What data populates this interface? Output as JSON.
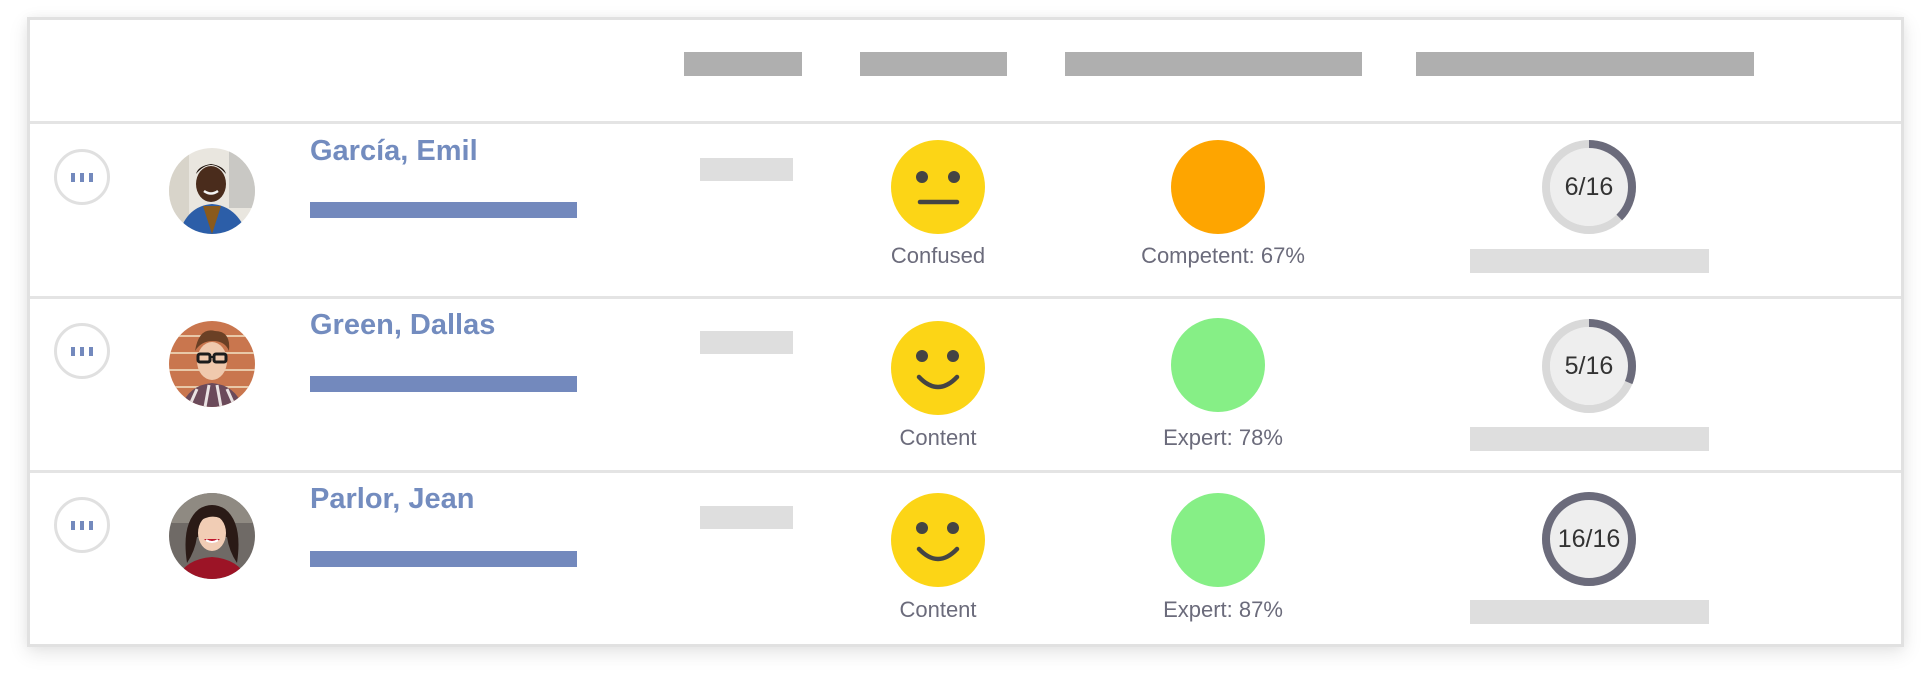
{
  "colors": {
    "accent": "#738cbf",
    "header_placeholder": "#afafaf",
    "row_placeholder": "#dedede",
    "mood_yellow": "#fcd516",
    "mood_features": "#444444",
    "status_competent": "#fea500",
    "status_expert": "#86ef86",
    "ring_track": "#d9d9d9",
    "ring_progress": "#6b6b7b",
    "ring_fill": "#eeeeee"
  },
  "rows": [
    {
      "name": "García, Emil",
      "avatar": "avatar-man-blue-jacket",
      "mood": {
        "label": "Confused",
        "icon": "neutral-face-icon"
      },
      "status": {
        "label": "Competent: 67%",
        "level": "competent"
      },
      "progress": {
        "label": "6/16",
        "completed": 6,
        "total": 16
      }
    },
    {
      "name": "Green, Dallas",
      "avatar": "avatar-man-glasses",
      "mood": {
        "label": "Content",
        "icon": "smiling-face-icon"
      },
      "status": {
        "label": "Expert: 78%",
        "level": "expert"
      },
      "progress": {
        "label": "5/16",
        "completed": 5,
        "total": 16
      }
    },
    {
      "name": "Parlor, Jean",
      "avatar": "avatar-woman-red-top",
      "mood": {
        "label": "Content",
        "icon": "smiling-face-icon"
      },
      "status": {
        "label": "Expert: 87%",
        "level": "expert"
      },
      "progress": {
        "label": "16/16",
        "completed": 16,
        "total": 16
      }
    }
  ]
}
